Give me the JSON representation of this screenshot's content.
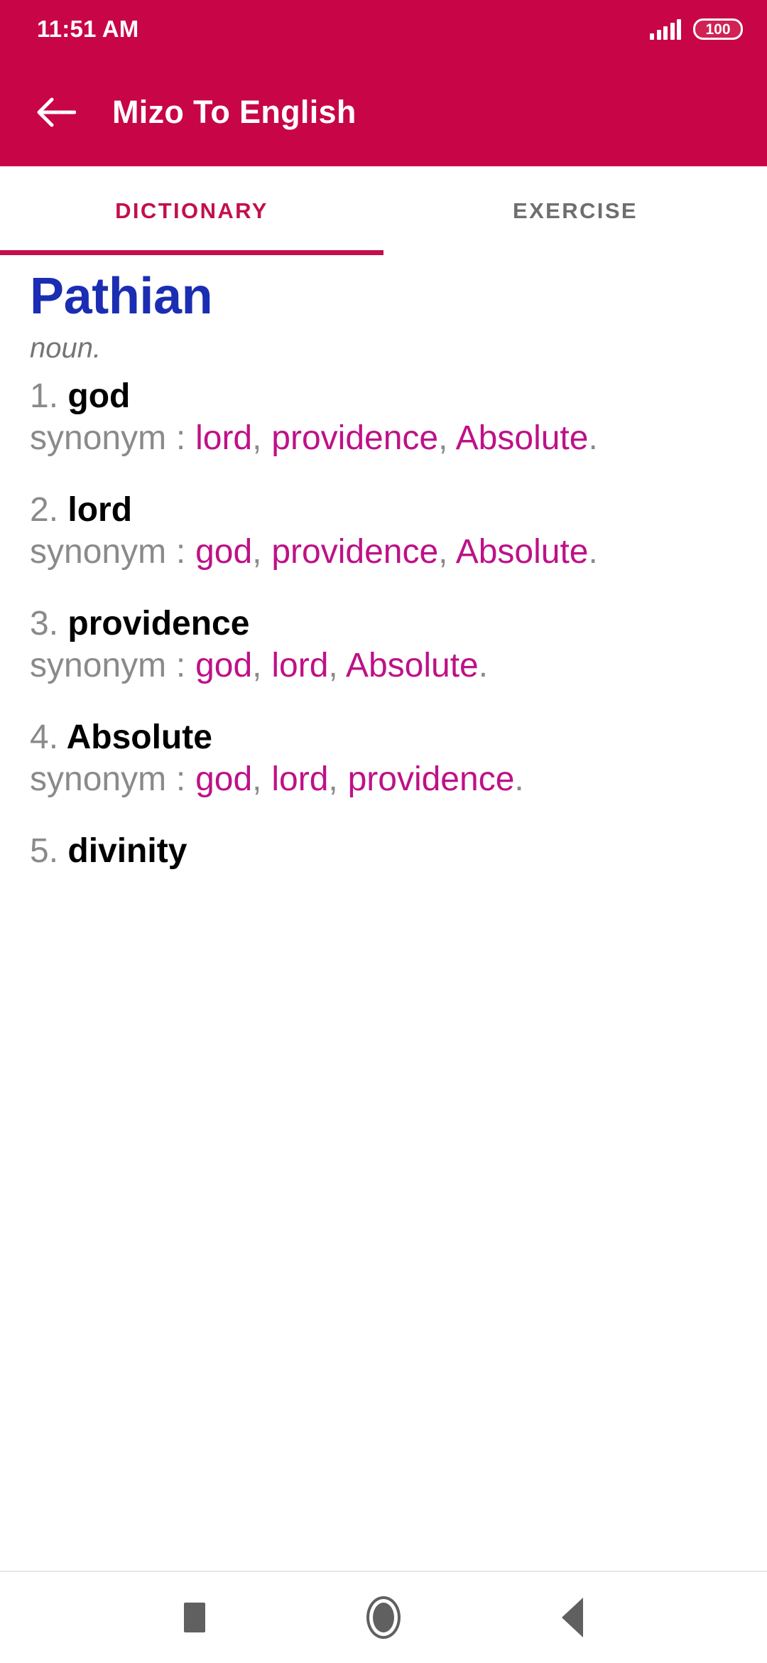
{
  "status_bar": {
    "time": "11:51 AM",
    "signal_icon": "signal-bars-icon",
    "battery_level": "100"
  },
  "app_bar": {
    "back_icon": "back-arrow-icon",
    "title": "Mizo To English",
    "background_color": "#C80546"
  },
  "tabs": {
    "items": [
      {
        "label": "DICTIONARY",
        "active": true
      },
      {
        "label": "EXERCISE",
        "active": false
      }
    ],
    "active_color": "#C2104B",
    "inactive_color": "#6E6E6E"
  },
  "dictionary_entry": {
    "headword": "Pathian",
    "headword_color": "#1B2DB2",
    "part_of_speech": "noun.",
    "synonym_label": "synonym",
    "synonym_separator": " : ",
    "comma": ", ",
    "period": ".",
    "synonym_color": "#BE1187",
    "senses": [
      {
        "number": "1.",
        "term": "god",
        "synonyms": [
          "lord",
          "providence",
          "Absolute"
        ]
      },
      {
        "number": "2.",
        "term": "lord",
        "synonyms": [
          "god",
          "providence",
          "Absolute"
        ]
      },
      {
        "number": "3.",
        "term": "providence",
        "synonyms": [
          "god",
          "lord",
          "Absolute"
        ]
      },
      {
        "number": "4.",
        "term": "Absolute",
        "synonyms": [
          "god",
          "lord",
          "providence"
        ]
      },
      {
        "number": "5.",
        "term": "divinity",
        "synonyms": []
      }
    ]
  },
  "nav_bar": {
    "recents_icon": "square-recents-icon",
    "home_icon": "circle-home-icon",
    "back_icon": "triangle-back-icon"
  }
}
